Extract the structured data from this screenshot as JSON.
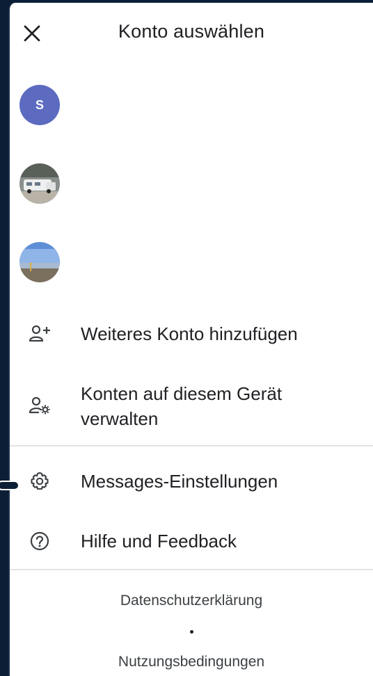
{
  "header": {
    "title": "Konto auswählen",
    "close_icon": "close-icon"
  },
  "accounts": [
    {
      "initial": "S",
      "color": "#5c6bc0"
    },
    {
      "photo": "camper-van"
    },
    {
      "photo": "beach-person"
    }
  ],
  "menu": {
    "add_account": "Weiteres Konto hinzufügen",
    "manage_accounts_line1": "Konten auf diesem Gerät",
    "manage_accounts_line2": "verwalten",
    "settings": "Messages-Einstellungen",
    "help": "Hilfe und Feedback"
  },
  "footer": {
    "privacy": "Datenschutzerklärung",
    "separator": "•",
    "terms": "Nutzungsbedingungen"
  },
  "colors": {
    "accent_avatar": "#5c6bc0",
    "text": "#202124",
    "divider": "#e3e3e3"
  }
}
